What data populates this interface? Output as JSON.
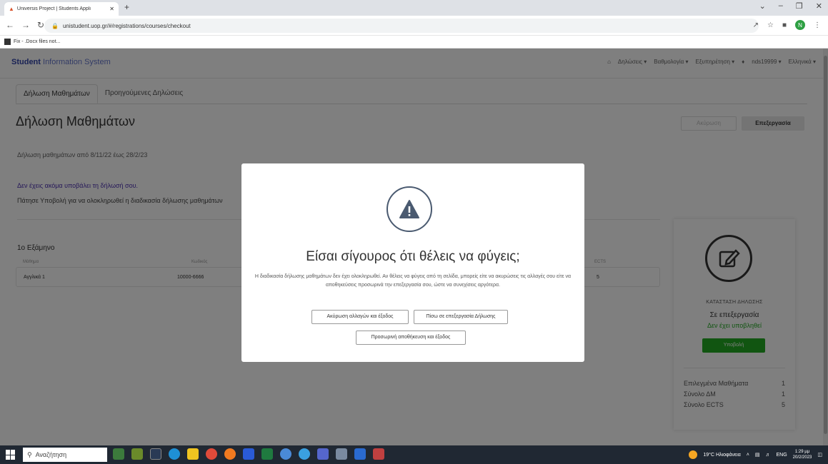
{
  "browser": {
    "tab_title": "Universis Project | Students Appli",
    "url": "unistudent.uop.gr/#/registrations/courses/checkout",
    "bookmark": "Fix - .Docx files not...",
    "profile_initial": "N"
  },
  "app": {
    "brand_bold": "Student",
    "brand_rest": " Information System",
    "nav": [
      "Δηλώσεις",
      "Βαθμολογία",
      "Εξυπηρέτηση",
      "nds19999",
      "Ελληνικά"
    ]
  },
  "tabs": [
    "Δήλωση Μαθημάτων",
    "Προηγούμενες Δηλώσεις"
  ],
  "page": {
    "title": "Δήλωση Μαθημάτων",
    "cancel_btn": "Ακύρωση",
    "edit_btn": "Επεξεργασία",
    "period": "Δήλωση μαθημάτων από 8/11/22 έως 28/2/23",
    "warning": "Δεν έχεις ακόμα υποβάλει τη δήλωσή σου.",
    "instruction": "Πάτησε Υποβολή για να ολοκληρωθεί η διαδικασία δήλωσης μαθημάτων"
  },
  "semester": {
    "title": "1ο Εξάμηνο",
    "columns": [
      "Μάθημα",
      "Κωδικός",
      "ECTS"
    ],
    "rows": [
      {
        "course": "Αγγλικά 1",
        "code": "10000-6666",
        "ects": "5"
      }
    ]
  },
  "status": {
    "heading": "ΚΑΤΑΣΤΑΣΗ ΔΗΛΩΣΗΣ",
    "state": "Σε επεξεργασία",
    "not_submitted": "Δεν έχει υποβληθεί",
    "submit_btn": "Υποβολή",
    "stats": [
      {
        "label": "Επιλεγμένα Μαθήματα",
        "value": "1"
      },
      {
        "label": "Σύνολο ΔΜ",
        "value": "1"
      },
      {
        "label": "Σύνολο ECTS",
        "value": "5"
      }
    ]
  },
  "modal": {
    "title": "Είσαι σίγουρος ότι θέλεις να φύγεις;",
    "text": "Η διαδικασία δήλωσης μαθημάτων δεν έχει ολοκληρωθεί. Αν θέλεις να φύγεις από τη σελίδα, μπορείς είτε να ακυρώσεις τις αλλαγές σου είτε να αποθηκεύσεις προσωρινά την επεξεργασία σου, ώστε να συνεχίσεις αργότερα.",
    "btn_discard": "Ακύρωση αλλαγών και έξοδος",
    "btn_back": "Πίσω σε επεξεργασία Δήλωσης",
    "btn_save": "Προσωρινή αποθήκευση και έξοδος"
  },
  "taskbar": {
    "search_placeholder": "Αναζήτηση",
    "weather": "19°C Ηλιοφάνεια",
    "lang": "ENG",
    "time": "1:29 μμ",
    "date": "20/2/2023"
  }
}
